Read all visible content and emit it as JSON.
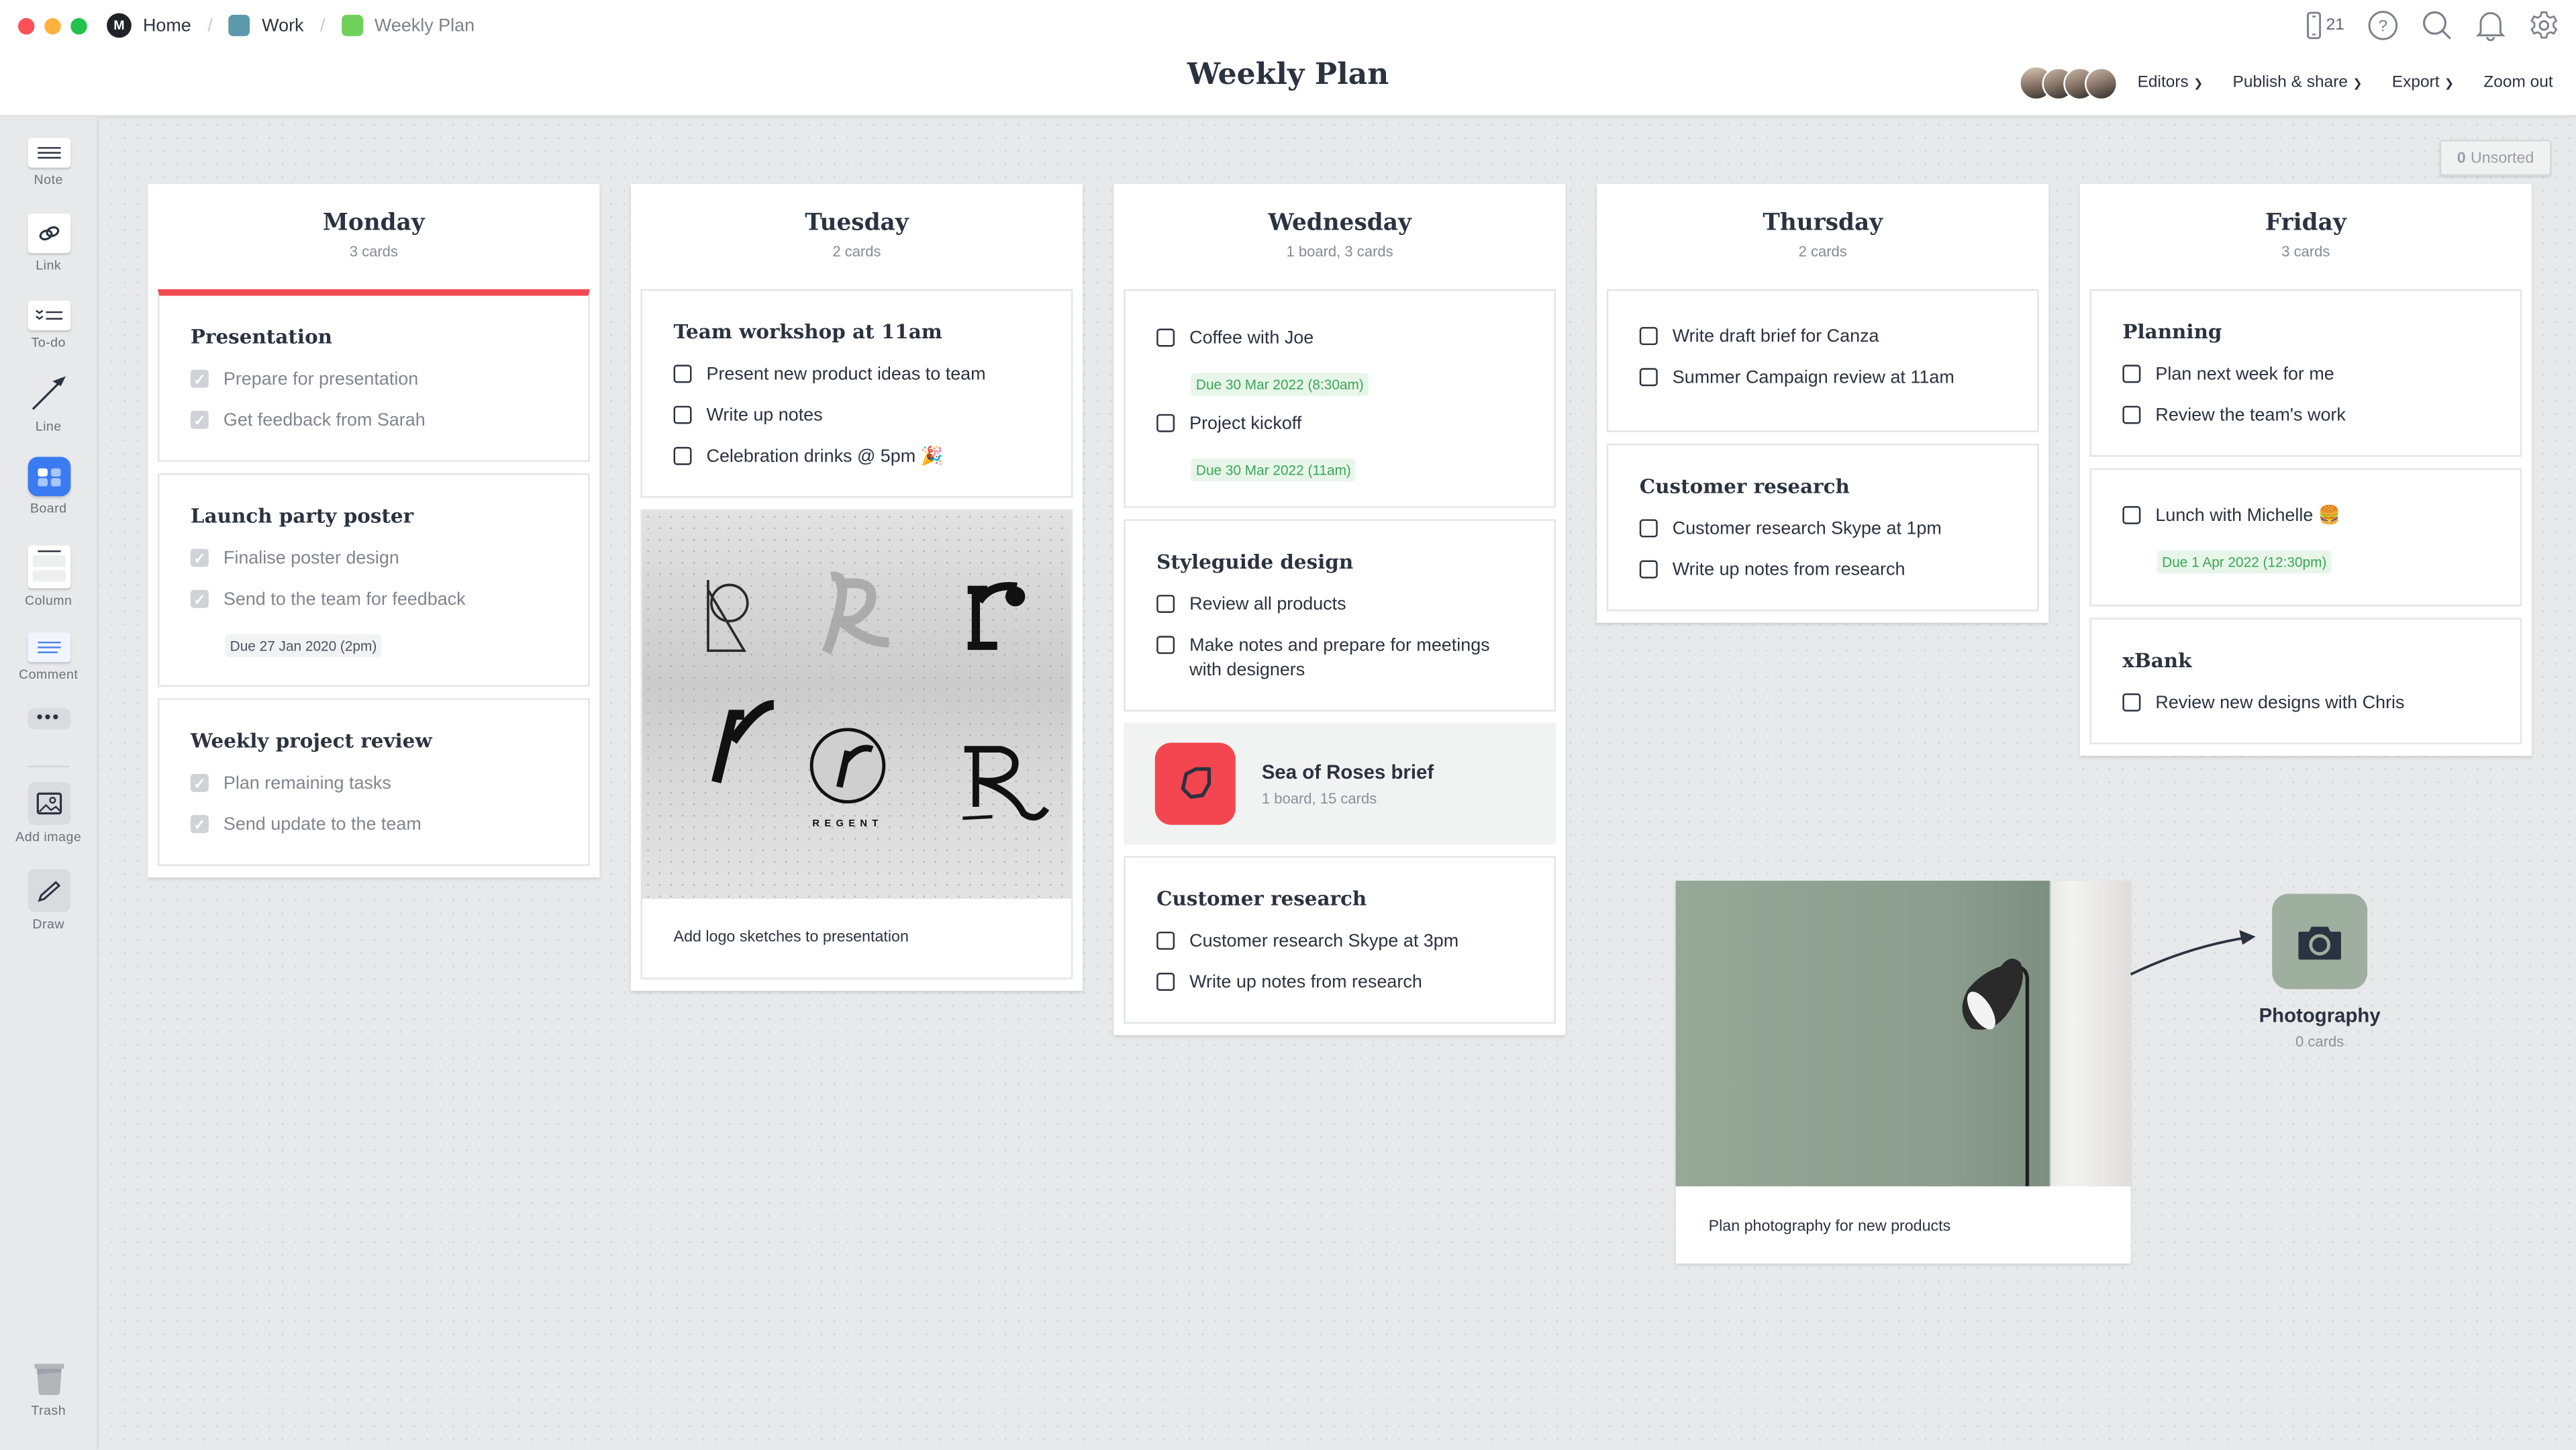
{
  "window": {
    "traffic_lights": {
      "close": "#ff4f57",
      "minimize": "#ffb13e",
      "zoom": "#22c34b"
    }
  },
  "breadcrumb": [
    {
      "label": "Home",
      "icon": "milanote-logo-icon"
    },
    {
      "label": "Work",
      "color": "#5b9aab"
    },
    {
      "label": "Weekly Plan",
      "color": "#6fd15a"
    }
  ],
  "header": {
    "title": "Weekly Plan",
    "device_count": "21",
    "actions": {
      "editors": "Editors",
      "publish": "Publish & share",
      "export": "Export",
      "zoom_out": "Zoom out"
    }
  },
  "sidebar": {
    "tools": [
      {
        "label": "Note",
        "icon": "note-icon"
      },
      {
        "label": "Link",
        "icon": "link-icon"
      },
      {
        "label": "To-do",
        "icon": "todo-icon"
      },
      {
        "label": "Line",
        "icon": "line-icon"
      },
      {
        "label": "Board",
        "icon": "board-icon"
      },
      {
        "label": "Column",
        "icon": "column-icon"
      },
      {
        "label": "Comment",
        "icon": "comment-icon"
      },
      {
        "label": "",
        "icon": "more-icon"
      },
      {
        "label": "Add image",
        "icon": "image-icon"
      },
      {
        "label": "Draw",
        "icon": "pencil-icon"
      }
    ],
    "trash": "Trash"
  },
  "unsorted": {
    "count": "0",
    "label": "Unsorted"
  },
  "columns": [
    {
      "title": "Monday",
      "subtitle": "3 cards",
      "cards": [
        {
          "title": "Presentation",
          "accent": "#f24a52",
          "todos": [
            {
              "text": "Prepare for presentation",
              "done": true
            },
            {
              "text": "Get feedback from Sarah",
              "done": true
            }
          ]
        },
        {
          "title": "Launch party poster",
          "todos": [
            {
              "text": "Finalise poster design",
              "done": true
            },
            {
              "text": "Send to the team for feedback",
              "done": true,
              "due": "Due 27 Jan 2020 (2pm)"
            }
          ]
        },
        {
          "title": "Weekly project review",
          "todos": [
            {
              "text": "Plan remaining tasks",
              "done": true
            },
            {
              "text": "Send update to the team",
              "done": true
            }
          ]
        }
      ]
    },
    {
      "title": "Tuesday",
      "subtitle": "2 cards",
      "cards": [
        {
          "title": "Team workshop at 11am",
          "todos": [
            {
              "text": "Present new product ideas to team",
              "done": false
            },
            {
              "text": "Write up notes",
              "done": false
            },
            {
              "text": "Celebration drinks @ 5pm 🎉",
              "done": false
            }
          ]
        }
      ],
      "image_card": {
        "caption": "Add logo sketches to presentation",
        "image": "logo-sketches-photo"
      }
    },
    {
      "title": "Wednesday",
      "subtitle": "1 board, 3 cards",
      "cards": [
        {
          "todos": [
            {
              "text": "Coffee with Joe",
              "done": false,
              "due": "Due 30 Mar 2022 (8:30am)"
            },
            {
              "text": "Project kickoff",
              "done": false,
              "due": "Due 30 Mar 2022 (11am)"
            }
          ]
        },
        {
          "title": "Styleguide design",
          "todos": [
            {
              "text": "Review all products",
              "done": false
            },
            {
              "text": "Make notes and prepare for meetings with designers",
              "done": false
            }
          ]
        }
      ],
      "board": {
        "title": "Sea of Roses brief",
        "subtitle": "1 board, 15 cards",
        "color": "#f44650"
      },
      "cards_after": [
        {
          "title": "Customer research",
          "todos": [
            {
              "text": "Customer research Skype at 3pm",
              "done": false
            },
            {
              "text": "Write up notes from research",
              "done": false
            }
          ]
        }
      ]
    },
    {
      "title": "Thursday",
      "subtitle": "2 cards",
      "cards": [
        {
          "todos": [
            {
              "text": "Write draft brief for Canza",
              "done": false
            },
            {
              "text": "Summer Campaign review at 11am",
              "done": false
            }
          ]
        },
        {
          "title": "Customer research",
          "todos": [
            {
              "text": "Customer research Skype at 1pm",
              "done": false
            },
            {
              "text": "Write up notes from research",
              "done": false
            }
          ]
        }
      ]
    },
    {
      "title": "Friday",
      "subtitle": "3 cards",
      "cards": [
        {
          "title": "Planning",
          "todos": [
            {
              "text": "Plan next week for me",
              "done": false
            },
            {
              "text": "Review the team's work",
              "done": false
            }
          ]
        },
        {
          "todos": [
            {
              "text": "Lunch with Michelle 🍔",
              "done": false,
              "due": "Due 1 Apr 2022 (12:30pm)"
            }
          ]
        },
        {
          "title": "xBank",
          "todos": [
            {
              "text": "Review new designs with Chris",
              "done": false
            }
          ]
        }
      ]
    }
  ],
  "photo_card": {
    "caption": "Plan photography for new products",
    "image": "floor-lamp-photo"
  },
  "photo_board": {
    "title": "Photography",
    "subtitle": "0 cards",
    "color": "#9eaf9f"
  }
}
